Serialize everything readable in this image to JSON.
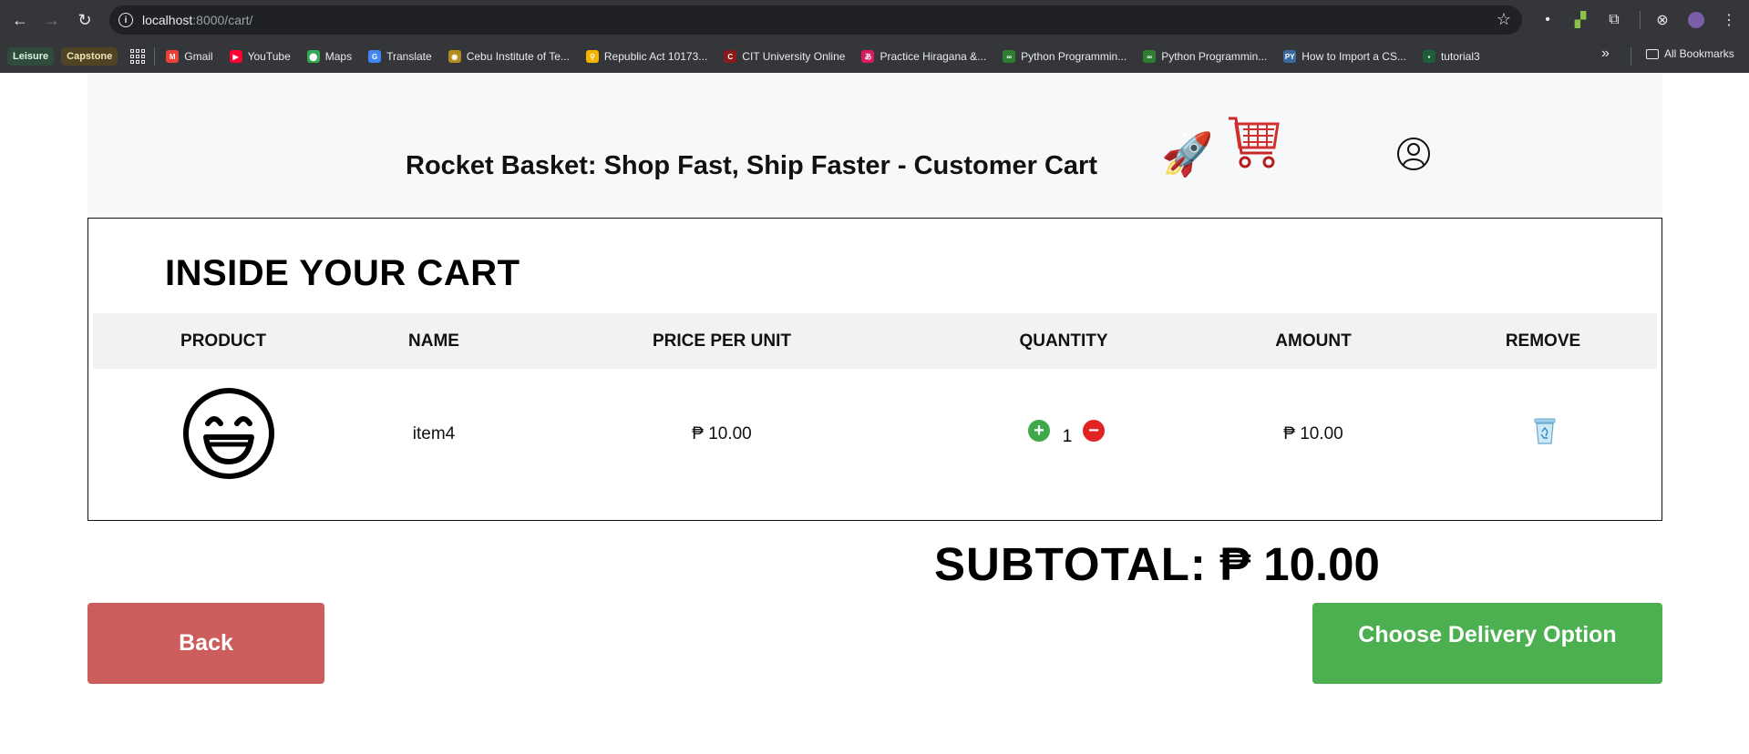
{
  "browser": {
    "url_host": "localhost",
    "url_rest": ":8000/cart/",
    "bookmarks": {
      "chips": [
        "Leisure",
        "Capstone"
      ],
      "items": [
        {
          "label": "Gmail",
          "color": "#ea4335",
          "glyph": "M"
        },
        {
          "label": "YouTube",
          "color": "#ff0033",
          "glyph": "▶"
        },
        {
          "label": "Maps",
          "color": "#34a853",
          "glyph": "⬤"
        },
        {
          "label": "Translate",
          "color": "#4285f4",
          "glyph": "G"
        },
        {
          "label": "Cebu Institute of Te...",
          "color": "#b58a1e",
          "glyph": "◉"
        },
        {
          "label": "Republic Act 10173...",
          "color": "#f4b400",
          "glyph": "⚲"
        },
        {
          "label": "CIT University Online",
          "color": "#8b1a1a",
          "glyph": "C"
        },
        {
          "label": "Practice Hiragana &...",
          "color": "#d81b60",
          "glyph": "あ"
        },
        {
          "label": "Python Programmin...",
          "color": "#2e7d32",
          "glyph": "∞"
        },
        {
          "label": "Python Programmin...",
          "color": "#2e7d32",
          "glyph": "∞"
        },
        {
          "label": "How to Import a CS...",
          "color": "#3b6aa0",
          "glyph": "PY"
        },
        {
          "label": "tutorial3",
          "color": "#1f5e3a",
          "glyph": "▪"
        }
      ],
      "all_bookmarks": "All Bookmarks"
    }
  },
  "header": {
    "title": "Rocket Basket: Shop Fast, Ship Faster - Customer Cart",
    "rocket_emoji": "🚀",
    "cart_emoji": "🛒"
  },
  "cart": {
    "heading": "INSIDE YOUR CART",
    "columns": [
      "PRODUCT",
      "NAME",
      "PRICE PER UNIT",
      "QUANTITY",
      "AMOUNT",
      "REMOVE"
    ],
    "items": [
      {
        "name": "item4",
        "price": "₱ 10.00",
        "quantity": "1",
        "amount": "₱ 10.00",
        "product_icon": "smiley-icon"
      }
    ]
  },
  "subtotal": {
    "label": "SUBTOTAL:",
    "value": "₱ 10.00"
  },
  "actions": {
    "back": "Back",
    "delivery": "Choose Delivery Option"
  },
  "colors": {
    "back_button": "#cd5c5c",
    "delivery_button": "#4caf50",
    "qty_plus": "#3fa84b",
    "qty_minus": "#e02424"
  }
}
